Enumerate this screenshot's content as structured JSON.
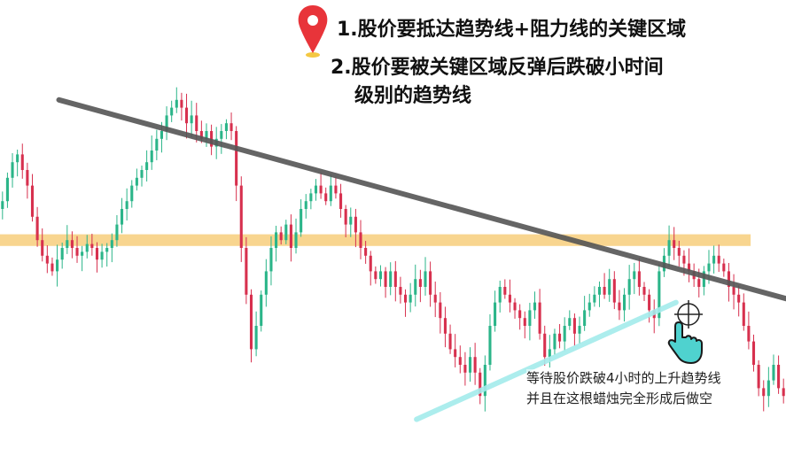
{
  "notes": {
    "line1": "1.股价要抵达趋势线+阻力线的关键区域",
    "line2a": "2.股价要被关键区域反弹后跌破小时间",
    "line2b": "级别的趋势线"
  },
  "caption": {
    "line1": "等待股价跌破4小时的上升趋势线",
    "line2": "并且在这根蜡烛完全形成后做空"
  },
  "icons": {
    "marker": "location-pin-icon",
    "hand": "pointer-hand-icon",
    "target": "crosshair-icon"
  },
  "colors": {
    "bull": "#2bb589",
    "bear": "#d7304e",
    "downtrend": "#555555",
    "resistance_zone": "#f5c76a",
    "uptrend": "#a4ecec",
    "pin": "#e8343a",
    "hand": "#4fd2cf"
  },
  "chart_data": {
    "type": "candlestick",
    "title": "",
    "xlabel": "",
    "ylabel": "",
    "ylim": [
      0,
      100
    ],
    "key_levels": {
      "resistance_zone": [
        50.5,
        53.5
      ],
      "downtrend_line": {
        "from": [
          0.075,
          88
        ],
        "to": [
          1.0,
          37
        ]
      },
      "uptrend_line": {
        "from": [
          0.53,
          6
        ],
        "to": [
          0.86,
          36
        ]
      }
    },
    "closes": [
      62,
      68,
      72,
      74,
      70,
      66,
      58,
      52,
      48,
      46,
      44,
      47,
      50,
      52,
      50,
      48,
      49,
      51,
      50,
      47,
      49,
      50,
      52,
      56,
      60,
      62,
      66,
      68,
      70,
      72,
      75,
      78,
      80,
      84,
      86,
      88,
      86,
      82,
      84,
      80,
      78,
      80,
      76,
      78,
      80,
      82,
      80,
      66,
      50,
      38,
      24,
      30,
      38,
      44,
      50,
      54,
      52,
      56,
      50,
      54,
      60,
      62,
      64,
      66,
      64,
      62,
      66,
      64,
      60,
      56,
      58,
      54,
      50,
      48,
      44,
      42,
      44,
      40,
      44,
      40,
      38,
      36,
      38,
      42,
      40,
      44,
      38,
      36,
      32,
      28,
      24,
      22,
      20,
      18,
      22,
      18,
      12,
      20,
      30,
      36,
      40,
      38,
      36,
      34,
      32,
      30,
      34,
      36,
      28,
      22,
      24,
      28,
      26,
      30,
      32,
      28,
      30,
      34,
      36,
      38,
      40,
      38,
      42,
      36,
      34,
      38,
      42,
      44,
      40,
      38,
      34,
      32,
      44,
      48,
      52,
      50,
      48,
      46,
      44,
      42,
      40,
      44,
      46,
      48,
      46,
      44,
      40,
      38,
      36,
      30,
      26,
      20,
      14,
      12,
      16,
      20,
      14,
      12
    ],
    "annotation": "等待股价跌破4小时的上升趋势线 并且在这根蜡烛完全形成后做空"
  }
}
